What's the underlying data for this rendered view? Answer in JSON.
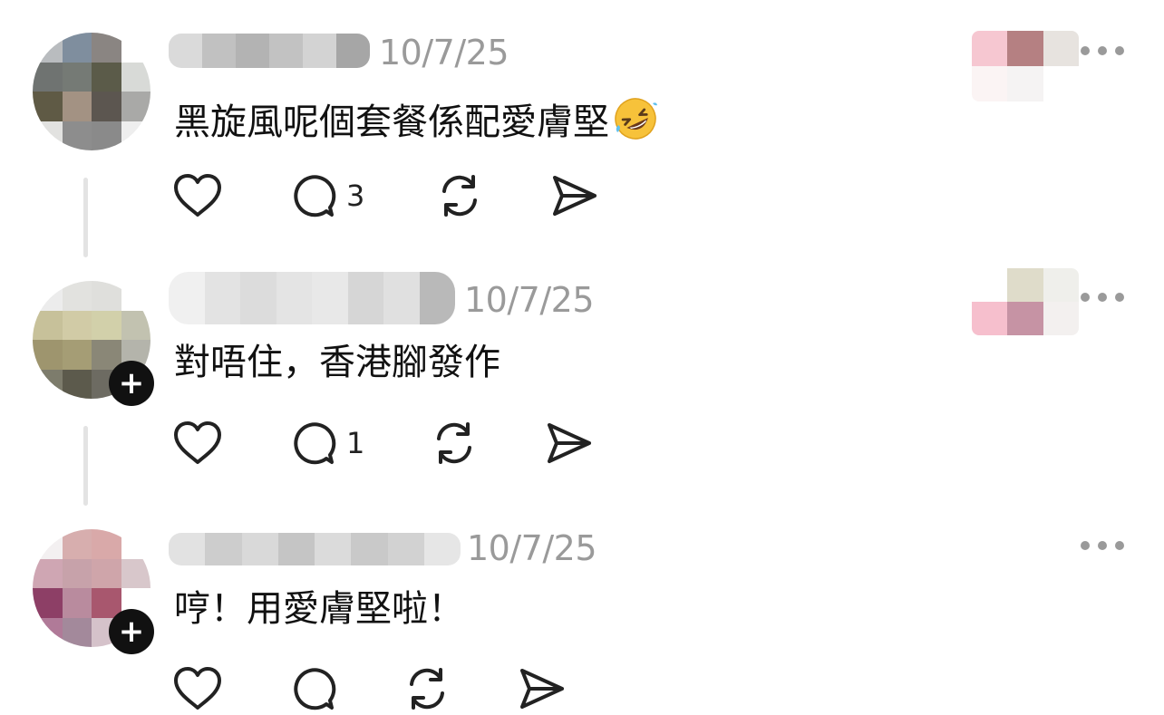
{
  "colors": {
    "text": "#111111",
    "timestamp": "#9a9a9a",
    "icon": "#222222",
    "thread_line": "#e3e3e3",
    "badge": "#111111"
  },
  "icons": {
    "like": "heart-icon",
    "reply": "speech-bubble-icon",
    "repost": "repost-arrows-icon",
    "share": "send-paper-plane-icon",
    "more": "more-dots-icon",
    "follow": "plus-icon"
  },
  "comments": [
    {
      "timestamp": "10/7/25",
      "text": "黑旋風呢個套餐係配愛膚堅",
      "emoji": "rolling-on-floor-laughing-emoji",
      "reply_count": "3",
      "like_count": ""
    },
    {
      "timestamp": "10/7/25",
      "text": "對唔住，香港腳發作",
      "reply_count": "1",
      "like_count": "",
      "follow_badge": "+"
    },
    {
      "timestamp": "10/7/25",
      "text": "哼！用愛膚堅啦！",
      "reply_count": "",
      "like_count": "",
      "follow_badge": "+"
    }
  ]
}
